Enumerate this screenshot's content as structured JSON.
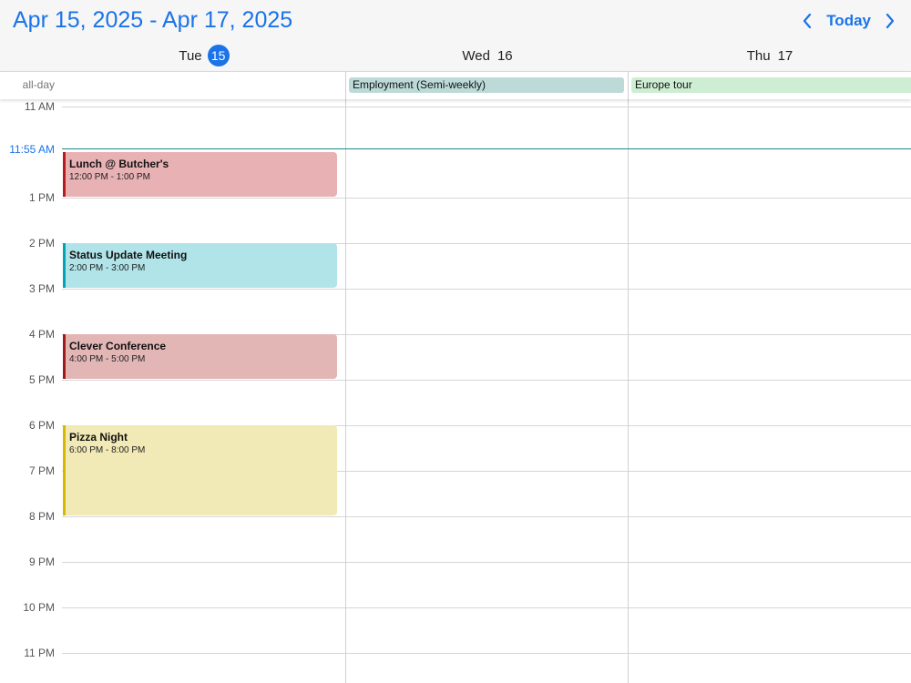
{
  "header": {
    "title": "Apr 15, 2025 - Apr 17, 2025",
    "today_label": "Today",
    "prev_icon": "chevron-left-icon",
    "next_icon": "chevron-right-icon"
  },
  "days": [
    {
      "name": "Tue",
      "num": "15",
      "is_today": true
    },
    {
      "name": "Wed",
      "num": "16",
      "is_today": false
    },
    {
      "name": "Thu",
      "num": "17",
      "is_today": false
    }
  ],
  "allday": {
    "label": "all-day",
    "events": [
      {
        "title": "Employment (Semi-weekly)",
        "color": "#bcdbd8",
        "day": "Wed"
      },
      {
        "title": "Europe tour",
        "color": "#cdeed3",
        "day": "Thu"
      }
    ]
  },
  "grid": {
    "hours": [
      "11 AM",
      "1 PM",
      "2 PM",
      "3 PM",
      "4 PM",
      "5 PM",
      "6 PM",
      "7 PM",
      "8 PM",
      "9 PM",
      "10 PM",
      "11 PM"
    ],
    "now_label": "11:55 AM",
    "now_color": "#1a73e8"
  },
  "events": [
    {
      "title": "Lunch @ Butcher's",
      "time": "12:00 PM - 1:00 PM",
      "bg": "#e8b2b4",
      "border": "#b71c1c",
      "day": "Tue"
    },
    {
      "title": "Status Update Meeting",
      "time": "2:00 PM - 3:00 PM",
      "bg": "#b1e4e9",
      "border": "#00a5b5",
      "day": "Tue"
    },
    {
      "title": "Clever Conference",
      "time": "4:00 PM - 5:00 PM",
      "bg": "#e3b6b6",
      "border": "#a11a1a",
      "day": "Tue"
    },
    {
      "title": "Pizza Night",
      "time": "6:00 PM - 8:00 PM",
      "bg": "#f2eab6",
      "border": "#d6b800",
      "day": "Tue"
    }
  ]
}
